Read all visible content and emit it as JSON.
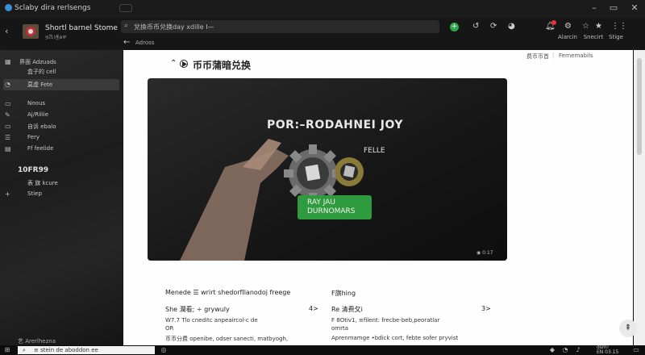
{
  "window": {
    "title": "Sclaby dira rerlsengs"
  },
  "header": {
    "app_title": "Shortl barnel Stome",
    "app_subtitle": "ዟቪነ፪ልዋ",
    "search_value": "兌換币币兑换day xdille  I—",
    "back_label": "Adross",
    "tools": [
      {
        "icon": "plus-circle-icon",
        "label": ""
      },
      {
        "icon": "history-icon",
        "label": ""
      },
      {
        "icon": "refresh-icon",
        "label": ""
      },
      {
        "icon": "paint-icon",
        "label": ""
      },
      {
        "icon": "notification-icon",
        "label": "Alarcin"
      },
      {
        "icon": "star-icon",
        "label": "Snecirt"
      },
      {
        "icon": "grid-icon",
        "label": "Stige"
      }
    ]
  },
  "sidebar": {
    "items": [
      {
        "icon": "grid-icon",
        "label": "界面 Adzuads"
      },
      {
        "icon": "blank",
        "label": "盒子的 cell"
      },
      {
        "icon": "clock-icon",
        "label": "莫虚 Fete",
        "active": true
      },
      {
        "icon": "folder-icon",
        "label": "Nnous"
      },
      {
        "icon": "paint-icon",
        "label": "Aj/Riliie"
      },
      {
        "icon": "folder-icon",
        "label": "自诉 ebalo"
      },
      {
        "icon": "list-icon",
        "label": "Fery"
      },
      {
        "icon": "calendar-icon",
        "label": "Ff feelide"
      }
    ],
    "section_label": "10FR99",
    "section_items": [
      {
        "icon": "blank",
        "label": "表 旗 kcure"
      },
      {
        "icon": "plus-icon",
        "label": "Stiep"
      }
    ],
    "footer_label": "艺  Arerlhezna"
  },
  "main": {
    "page_title": "币币蒲暗兑换",
    "right_links": [
      "费币币首",
      "Fernemabils"
    ],
    "video": {
      "title": "POR:–RODAHNEI JOY",
      "feature": "FELLE",
      "button_line1": "RAY JAU",
      "button_line2": "DURNOMARS",
      "time": "◉ 0:17"
    },
    "left_col": {
      "heading": "Menede ☰ wrirt shedorfIlanodoj freege",
      "row1": "She 潤看; ÷ grywuly",
      "row1_arrow": "4>",
      "row2": "W7.7  Tlo cneditc anpeaircol-c de",
      "row3": "OR",
      "row4": "币币分费 openibe, odser sanecti, matbyogh,"
    },
    "right_col": {
      "heading": "F旗hing",
      "row1": "Re 清费攵i",
      "row1_arrow": "3>",
      "row2": "F 8Otiv1, ≡filent: frecbe-beb,peoratlar",
      "row3": "omrta",
      "row4": "Aprenmamge  •bdick cort, febte sofer pryvist"
    }
  },
  "taskbar": {
    "search_text": "≡ stein de aboddon ee",
    "clock_line1": "dsm!",
    "clock_line2": "EN 03.15"
  }
}
